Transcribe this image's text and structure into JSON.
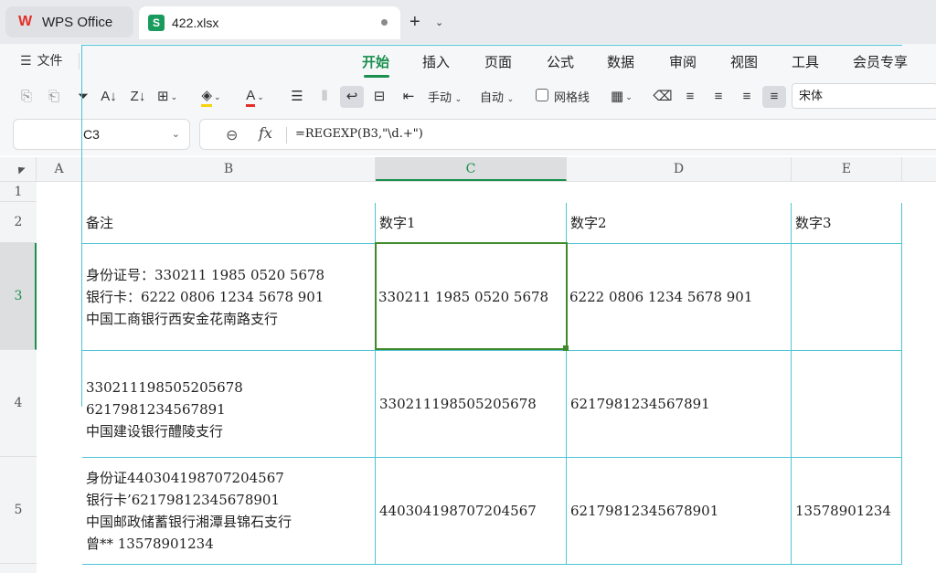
{
  "tabs": {
    "app_label": "WPS Office",
    "file_label": "422.xlsx",
    "new_tab_symbol": "+",
    "new_tab_dropdown": "⌄"
  },
  "menu": {
    "file_label": "文件",
    "ribbon_tabs": [
      "开始",
      "插入",
      "页面",
      "公式",
      "数据",
      "审阅",
      "视图",
      "工具",
      "会员专享"
    ],
    "active_tab": "开始"
  },
  "toolbar": {
    "manual_label": "手动",
    "auto_label": "自动",
    "gridlines_label": "网格线",
    "gridlines_checked": false,
    "font_name": "宋体"
  },
  "formula_bar": {
    "cell_ref": "C3",
    "fx_symbol": "fx",
    "formula": "=REGEXP(B3,\"\\d.+\")"
  },
  "grid": {
    "columns": [
      "A",
      "B",
      "C",
      "D",
      "E"
    ],
    "selected_column": "C",
    "rows": [
      "1",
      "2",
      "3",
      "4",
      "5"
    ],
    "selected_row": "3",
    "header_row": {
      "B": "备注",
      "C": "数字1",
      "D": "数字2",
      "E": "数字3"
    },
    "data_rows": [
      {
        "row": "3",
        "B": "身份证号：330211 1985 0520 5678\n银行卡：6222 0806 1234 5678 901\n中国工商银行西安金花南路支行",
        "C": "330211 1985 0520 5678",
        "D": "6222 0806 1234 5678 901",
        "E": ""
      },
      {
        "row": "4",
        "B": "330211198505205678\n6217981234567891\n中国建设银行醴陵支行",
        "C": "330211198505205678",
        "D": "6217981234567891",
        "E": ""
      },
      {
        "row": "5",
        "B": "身份证440304198707204567\n银行卡’62179812345678901\n中国邮政储蓄银行湘潭县锦石支行\n曾** 13578901234",
        "C": "440304198707204567",
        "D": "62179812345678901",
        "E": "13578901234"
      }
    ]
  },
  "colors": {
    "accent_green": "#1a8f4e",
    "table_border": "#4fc3d5",
    "selection_border": "#3f8a2a"
  }
}
